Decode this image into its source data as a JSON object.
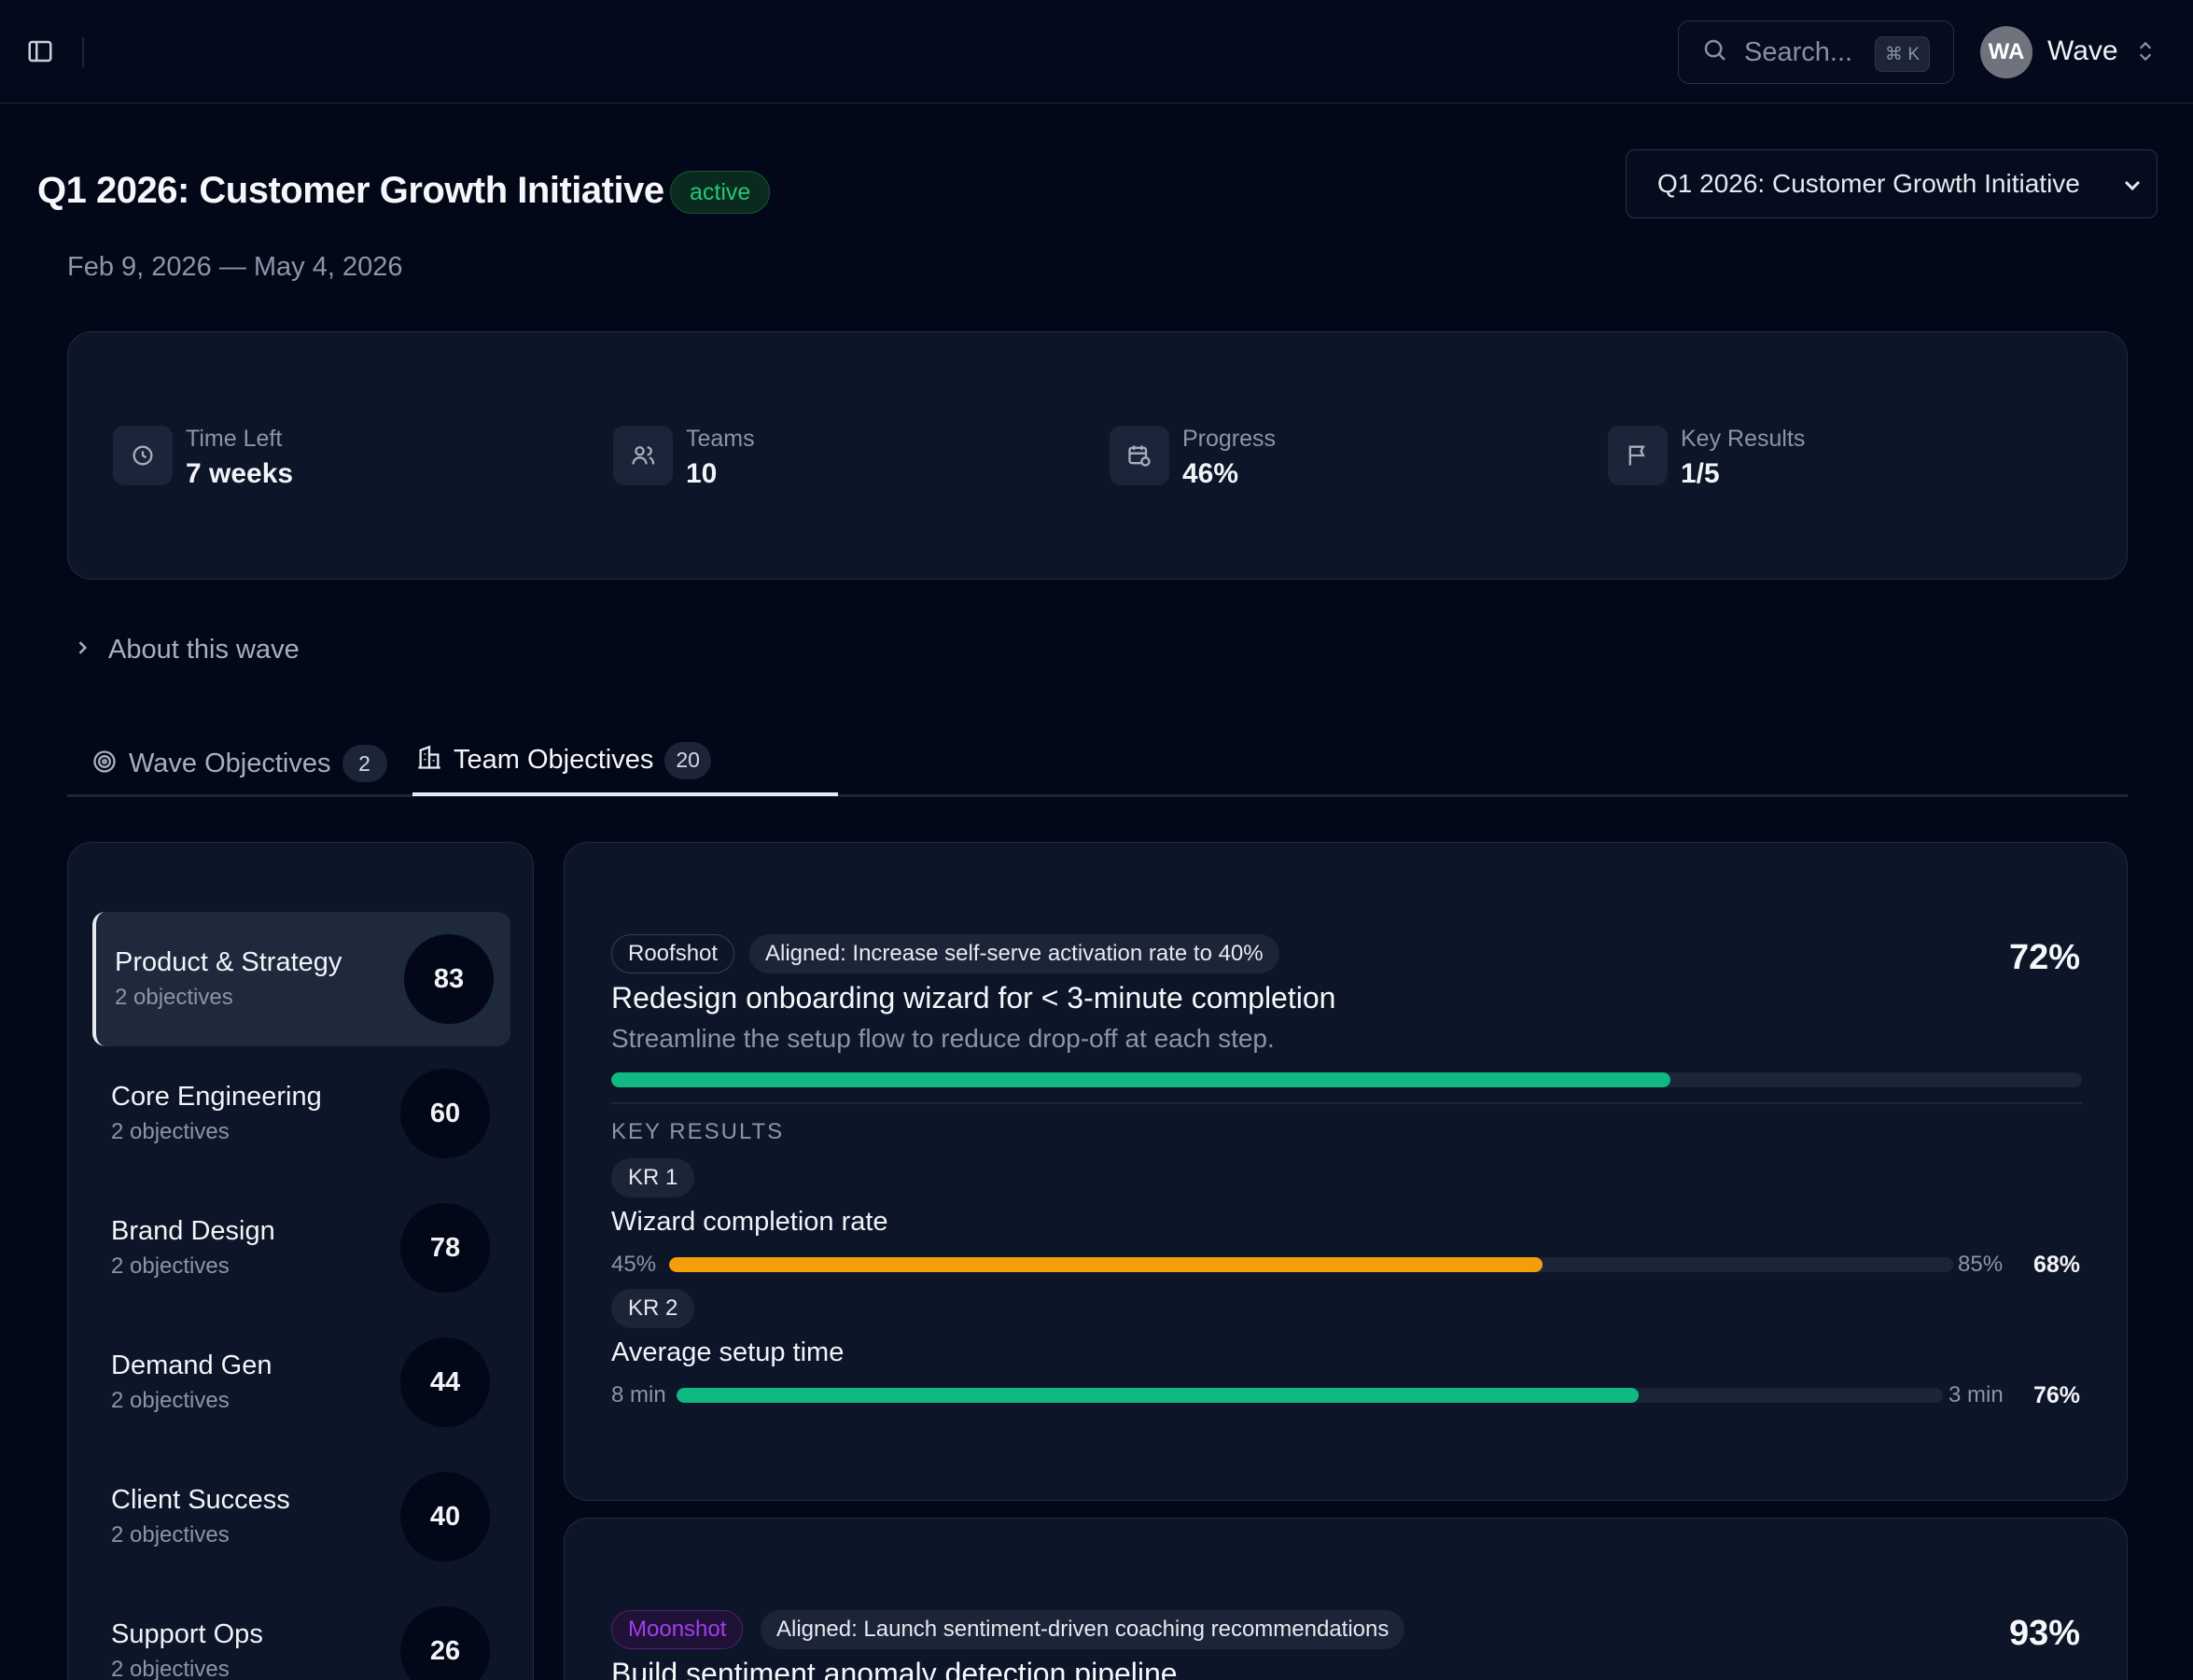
{
  "header": {
    "search_placeholder": "Search...",
    "search_shortcut": "⌘ K",
    "avatar_initials": "WA",
    "workspace_name": "Wave"
  },
  "wave": {
    "title": "Q1 2026: Customer Growth Initiative",
    "status": "active",
    "date_range": "Feb 9, 2026 — May 4, 2026",
    "selector_value": "Q1 2026: Customer Growth Initiative"
  },
  "stats": [
    {
      "label": "Time Left",
      "value": "7 weeks",
      "icon": "clock-icon"
    },
    {
      "label": "Teams",
      "value": "10",
      "icon": "users-icon"
    },
    {
      "label": "Progress",
      "value": "46%",
      "icon": "calendar-clock-icon"
    },
    {
      "label": "Key Results",
      "value": "1/5",
      "icon": "flag-icon"
    }
  ],
  "about_label": "About this wave",
  "tabs": [
    {
      "label": "Wave Objectives",
      "count": "2",
      "active": false,
      "icon": "target-icon"
    },
    {
      "label": "Team Objectives",
      "count": "20",
      "active": true,
      "icon": "building-icon"
    }
  ],
  "teams": [
    {
      "name": "Product & Strategy",
      "sub": "2 objectives",
      "score": "83"
    },
    {
      "name": "Core Engineering",
      "sub": "2 objectives",
      "score": "60"
    },
    {
      "name": "Brand Design",
      "sub": "2 objectives",
      "score": "78"
    },
    {
      "name": "Demand Gen",
      "sub": "2 objectives",
      "score": "44"
    },
    {
      "name": "Client Success",
      "sub": "2 objectives",
      "score": "40"
    },
    {
      "name": "Support Ops",
      "sub": "2 objectives",
      "score": "26"
    }
  ],
  "objectives": [
    {
      "tag": "Roofshot",
      "aligned": "Aligned: Increase self-serve activation rate to 40%",
      "title": "Redesign onboarding wizard for < 3-minute completion",
      "description": "Streamline the setup flow to reduce drop-off at each step.",
      "percent": "72%",
      "progress": 0.72,
      "bar_color": "#10b981",
      "key_results_label": "KEY RESULTS",
      "key_results": [
        {
          "tag": "KR 1",
          "name": "Wizard completion rate",
          "start": "45%",
          "target": "85%",
          "percent": "68%",
          "progress": 0.68,
          "color": "#f59e0b"
        },
        {
          "tag": "KR 2",
          "name": "Average setup time",
          "start": "8 min",
          "target": "3 min",
          "percent": "76%",
          "progress": 0.76,
          "color": "#10b981"
        }
      ]
    },
    {
      "tag": "Moonshot",
      "aligned": "Aligned: Launch sentiment-driven coaching recommendations",
      "title": "Build sentiment anomaly detection pipeline",
      "percent": "93%"
    }
  ],
  "colors": {
    "background": "#030818",
    "card": "#0d1528",
    "active_green": "#22c77a",
    "progress_green": "#10b981",
    "progress_amber": "#f59e0b",
    "moonshot_purple": "#a23df0"
  }
}
